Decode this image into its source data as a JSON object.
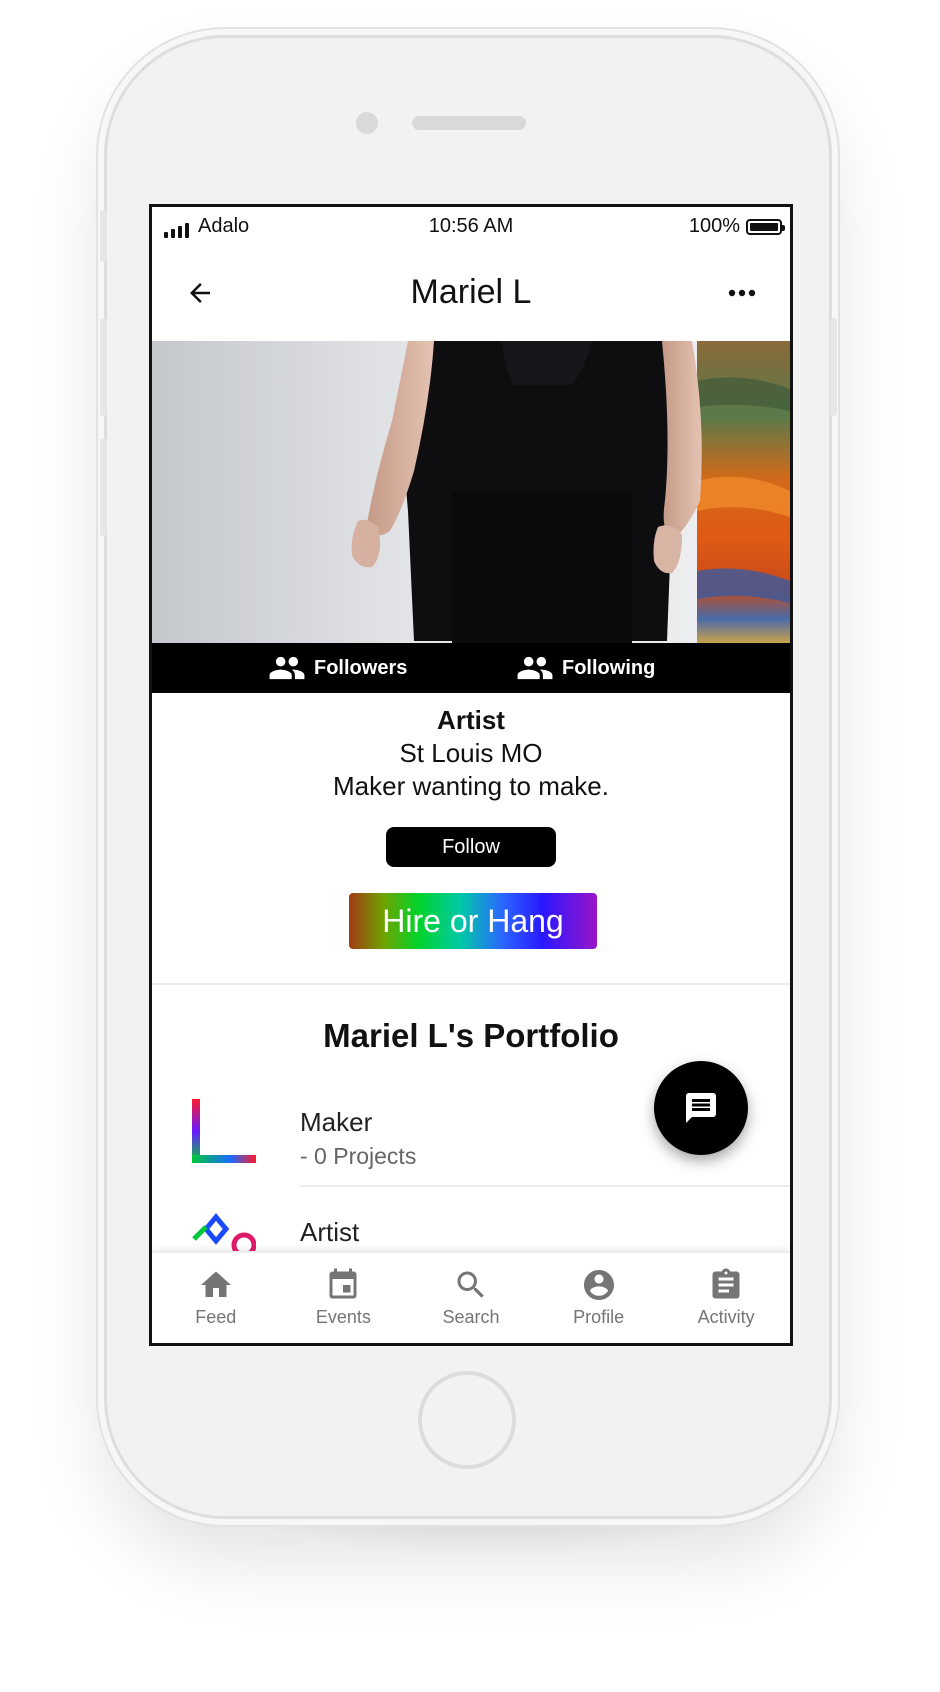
{
  "status_bar": {
    "carrier": "Adalo",
    "time": "10:56 AM",
    "battery": "100%"
  },
  "header": {
    "title": "Mariel L",
    "back_icon": "arrow-left-icon",
    "menu_icon": "more-horizontal-icon"
  },
  "hero": {
    "image": "profile-cover-photo"
  },
  "social": {
    "followers_label": "Followers",
    "following_label": "Following",
    "icon": "people-icon"
  },
  "bio": {
    "role": "Artist",
    "location": "St Louis MO",
    "description": "Maker wanting to make."
  },
  "actions": {
    "follow_label": "Follow",
    "hire_label": "Hire or Hang"
  },
  "portfolio": {
    "title": "Mariel L's Portfolio",
    "items": [
      {
        "title": "Maker",
        "subtitle": "- 0 Projects",
        "icon": "rainbow-l-icon"
      },
      {
        "title": "Artist",
        "subtitle": "",
        "icon": "rainbow-shapes-icon"
      }
    ]
  },
  "fab": {
    "icon": "chat-icon"
  },
  "tabs": [
    {
      "label": "Feed",
      "icon": "home-icon"
    },
    {
      "label": "Events",
      "icon": "calendar-icon"
    },
    {
      "label": "Search",
      "icon": "search-icon"
    },
    {
      "label": "Profile",
      "icon": "account-circle-icon"
    },
    {
      "label": "Activity",
      "icon": "clipboard-icon"
    }
  ],
  "colors": {
    "primary": "#000000",
    "tab_inactive": "#757575",
    "divider": "#ececec"
  }
}
